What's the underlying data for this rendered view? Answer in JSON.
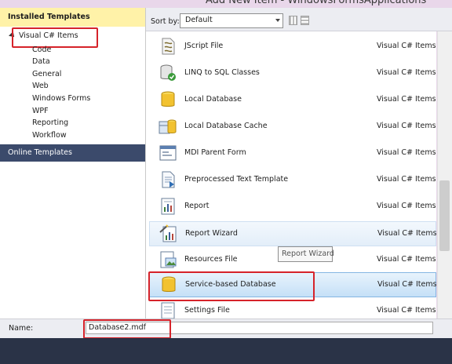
{
  "window": {
    "title": "Add New Item - WindowsFormsApplications"
  },
  "left_panel": {
    "installed_header": "Installed Templates",
    "root_item": "Visual C# Items",
    "children": [
      "Code",
      "Data",
      "General",
      "Web",
      "Windows Forms",
      "WPF",
      "Reporting",
      "Workflow"
    ],
    "online_header": "Online Templates"
  },
  "sort": {
    "label": "Sort by:",
    "value": "Default"
  },
  "templates": [
    {
      "name": "JScript File",
      "category": "Visual C# Items",
      "icon": "script-file-icon"
    },
    {
      "name": "LINQ to SQL Classes",
      "category": "Visual C# Items",
      "icon": "linq-classes-icon"
    },
    {
      "name": "Local Database",
      "category": "Visual C# Items",
      "icon": "database-icon"
    },
    {
      "name": "Local Database Cache",
      "category": "Visual C# Items",
      "icon": "database-cache-icon"
    },
    {
      "name": "MDI Parent Form",
      "category": "Visual C# Items",
      "icon": "form-icon"
    },
    {
      "name": "Preprocessed Text Template",
      "category": "Visual C# Items",
      "icon": "text-template-icon"
    },
    {
      "name": "Report",
      "category": "Visual C# Items",
      "icon": "report-icon"
    },
    {
      "name": "Report Wizard",
      "category": "Visual C# Items",
      "icon": "report-wizard-icon"
    },
    {
      "name": "Resources File",
      "category": "Visual C# Items",
      "icon": "resources-icon"
    },
    {
      "name": "Service-based Database",
      "category": "Visual C# Items",
      "icon": "database-icon"
    },
    {
      "name": "Settings File",
      "category": "Visual C# Items",
      "icon": "settings-file-icon"
    }
  ],
  "tooltip": "Report Wizard",
  "name_field": {
    "label": "Name:",
    "value": "Database2.mdf"
  },
  "colors": {
    "highlight_box": "#d6232a",
    "installed_header_bg": "#fff2a8",
    "online_header_bg": "#3b4a6b",
    "footer_bg": "#2a3347",
    "selected_row": "#c5e0f7"
  }
}
